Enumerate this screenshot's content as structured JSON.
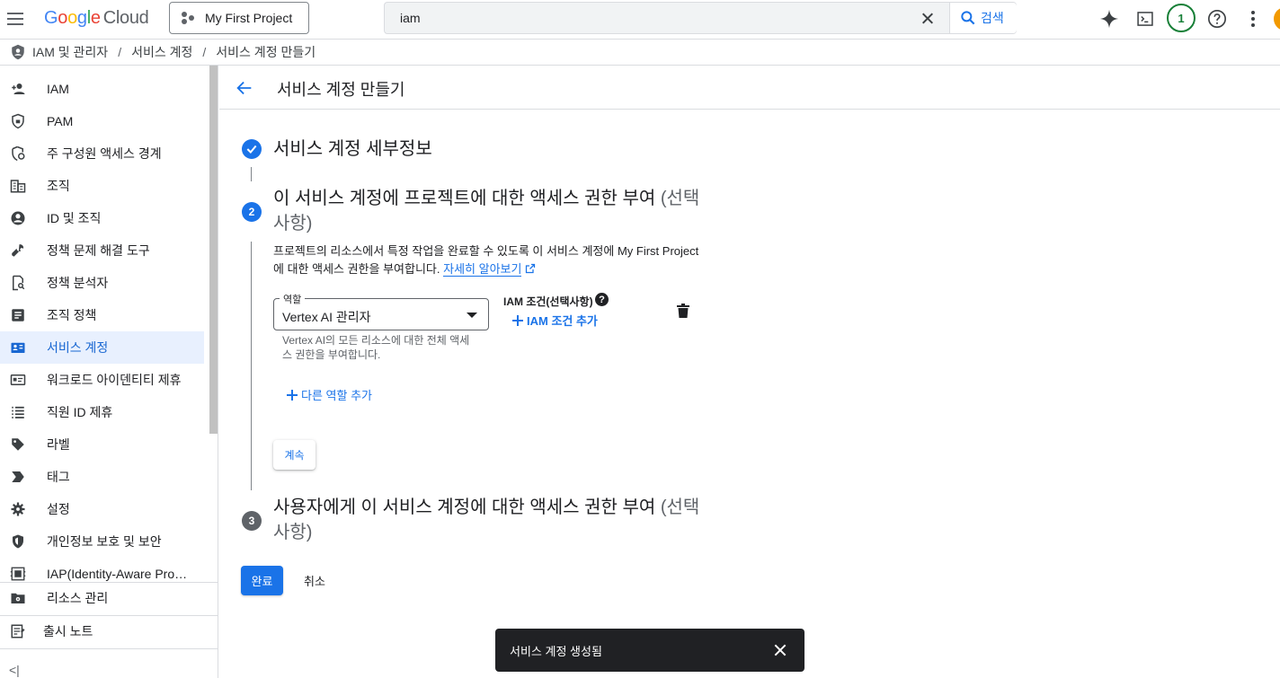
{
  "header": {
    "logo_google": [
      "G",
      "o",
      "o",
      "g",
      "l",
      "e"
    ],
    "logo_cloud": "Cloud",
    "project_name": "My First Project",
    "search_value": "iam",
    "search_button_label": "검색",
    "notification_count": "1"
  },
  "breadcrumb": {
    "items": [
      "IAM 및 관리자",
      "서비스 계정",
      "서비스 계정 만들기"
    ],
    "separator": "/"
  },
  "sidebar": {
    "items": [
      {
        "label": "IAM",
        "icon": "person-add-icon"
      },
      {
        "label": "PAM",
        "icon": "shield-lock-icon"
      },
      {
        "label": "주 구성원 액세스 경계",
        "icon": "access-boundary-icon"
      },
      {
        "label": "조직",
        "icon": "organization-icon"
      },
      {
        "label": "ID 및 조직",
        "icon": "account-circle-icon"
      },
      {
        "label": "정책 문제 해결 도구",
        "icon": "wrench-icon"
      },
      {
        "label": "정책 분석자",
        "icon": "policy-analyzer-icon"
      },
      {
        "label": "조직 정책",
        "icon": "document-icon"
      },
      {
        "label": "서비스 계정",
        "icon": "service-account-icon",
        "active": true
      },
      {
        "label": "워크로드 아이덴티티 제휴",
        "icon": "id-card-icon"
      },
      {
        "label": "직원 ID 제휴",
        "icon": "list-icon"
      },
      {
        "label": "라벨",
        "icon": "label-icon"
      },
      {
        "label": "태그",
        "icon": "tag-arrow-icon"
      },
      {
        "label": "설정",
        "icon": "gear-icon"
      },
      {
        "label": "개인정보 보호 및 보안",
        "icon": "privacy-shield-icon"
      },
      {
        "label": "IAP(Identity-Aware Pro…",
        "icon": "iap-icon"
      }
    ],
    "bottom_items": [
      {
        "label": "리소스 관리",
        "icon": "folder-gear-icon"
      },
      {
        "label": "출시 노트",
        "icon": "release-notes-icon"
      }
    ],
    "collapse_label": "<|"
  },
  "page": {
    "title": "서비스 계정 만들기",
    "step1_title": "서비스 계정 세부정보",
    "step2_number": "2",
    "step2_title": "이 서비스 계정에 프로젝트에 대한 액세스 권한 부여",
    "step2_optional": "(선택사항)",
    "step2_description": "프로젝트의 리소스에서 특정 작업을 완료할 수 있도록 이 서비스 계정에 My First Project에 대한 액세스 권한을 부여합니다.",
    "learn_more": "자세히 알아보기",
    "role_legend": "역할",
    "role_value": "Vertex AI 관리자",
    "role_hint": "Vertex AI의 모든 리소스에 대한 전체 액세스 권한을 부여합니다.",
    "iam_condition_label": "IAM 조건(선택사항)",
    "help_glyph": "?",
    "add_iam_condition": "IAM 조건 추가",
    "add_role": "다른 역할 추가",
    "continue_label": "계속",
    "step3_number": "3",
    "step3_title": "사용자에게 이 서비스 계정에 대한 액세스 권한 부여",
    "step3_optional": "(선택사항)",
    "done_label": "완료",
    "cancel_label": "취소"
  },
  "snackbar": {
    "message": "서비스 계정 생성됨"
  },
  "colors": {
    "accent": "#1a73e8",
    "step_complete": "#1a73e8",
    "step_active": "#1a73e8",
    "step_inactive": "#5f6368",
    "notification": "#188038",
    "active_nav_bg": "#e8f0fe"
  }
}
